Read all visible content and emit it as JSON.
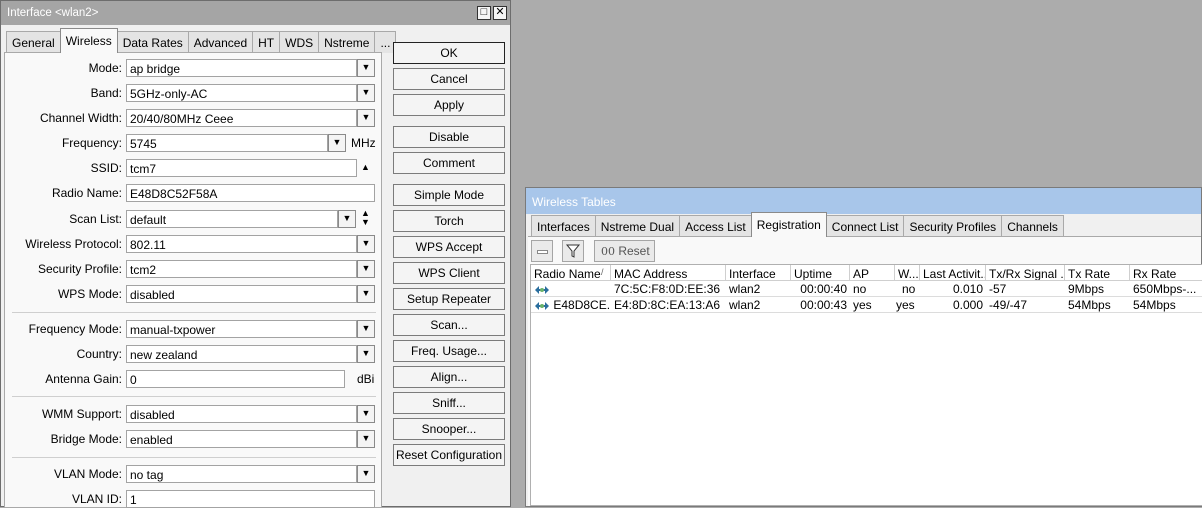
{
  "interface_window": {
    "title": "Interface <wlan2>",
    "tabs": [
      "General",
      "Wireless",
      "Data Rates",
      "Advanced",
      "HT",
      "WDS",
      "Nstreme",
      "..."
    ],
    "active_tab": "Wireless",
    "fields": {
      "mode": {
        "label": "Mode:",
        "value": "ap bridge"
      },
      "band": {
        "label": "Band:",
        "value": "5GHz-only-AC"
      },
      "channel_width": {
        "label": "Channel Width:",
        "value": "20/40/80MHz Ceee"
      },
      "frequency": {
        "label": "Frequency:",
        "value": "5745",
        "unit": "MHz"
      },
      "ssid": {
        "label": "SSID:",
        "value": "tcm7"
      },
      "radio_name": {
        "label": "Radio Name:",
        "value": "E48D8C52F58A"
      },
      "scan_list": {
        "label": "Scan List:",
        "value": "default"
      },
      "wireless_protocol": {
        "label": "Wireless Protocol:",
        "value": "802.11"
      },
      "security_profile": {
        "label": "Security Profile:",
        "value": "tcm2"
      },
      "wps_mode": {
        "label": "WPS Mode:",
        "value": "disabled"
      },
      "frequency_mode": {
        "label": "Frequency Mode:",
        "value": "manual-txpower"
      },
      "country": {
        "label": "Country:",
        "value": "new zealand"
      },
      "antenna_gain": {
        "label": "Antenna Gain:",
        "value": "0",
        "unit": "dBi"
      },
      "wmm_support": {
        "label": "WMM Support:",
        "value": "disabled"
      },
      "bridge_mode": {
        "label": "Bridge Mode:",
        "value": "enabled"
      },
      "vlan_mode": {
        "label": "VLAN Mode:",
        "value": "no tag"
      },
      "vlan_id": {
        "label": "VLAN ID:",
        "value": "1"
      }
    },
    "buttons": [
      "OK",
      "Cancel",
      "Apply",
      "Disable",
      "Comment",
      "Simple Mode",
      "Torch",
      "WPS Accept",
      "WPS Client",
      "Setup Repeater",
      "Scan...",
      "Freq. Usage...",
      "Align...",
      "Sniff...",
      "Snooper...",
      "Reset Configuration"
    ]
  },
  "wireless_tables": {
    "title": "Wireless Tables",
    "tabs": [
      "Interfaces",
      "Nstreme Dual",
      "Access List",
      "Registration",
      "Connect List",
      "Security Profiles",
      "Channels"
    ],
    "active_tab": "Registration",
    "reset_label": "Reset",
    "reset_icon_text": "00",
    "columns": [
      "Radio Name",
      "MAC Address",
      "Interface",
      "Uptime",
      "AP",
      "W...",
      "Last Activit...",
      "Tx/Rx Signal ...",
      "Tx Rate",
      "Rx Rate"
    ],
    "sort_indicator": "/",
    "rows": [
      [
        "",
        "7C:5C:F8:0D:EE:36",
        "wlan2",
        "00:00:40",
        "no",
        "no",
        "0.010",
        "-57",
        "9Mbps",
        "650Mbps-..."
      ],
      [
        "E48D8CE...",
        "E4:8D:8C:EA:13:A6",
        "wlan2",
        "00:00:43",
        "yes",
        "yes",
        "0.000",
        "-49/-47",
        "54Mbps",
        "54Mbps"
      ]
    ]
  }
}
